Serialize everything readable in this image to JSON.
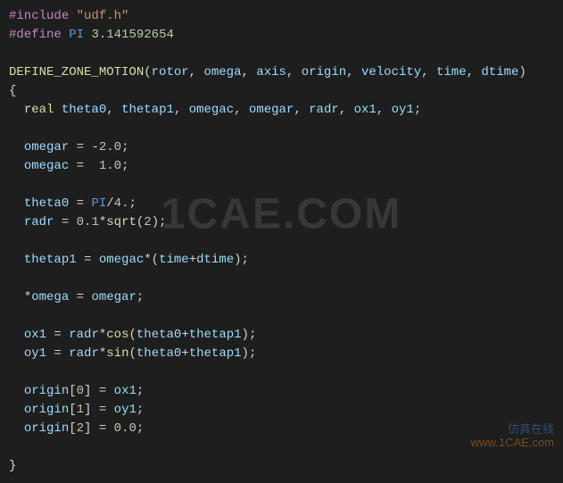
{
  "code": {
    "line01": {
      "hash": "#",
      "include": "include",
      "space": " ",
      "header": "\"udf.h\""
    },
    "line02": {
      "hash": "#",
      "define": "define",
      "space1": " ",
      "macro": "PI",
      "space2": " ",
      "value": "3.141592654"
    },
    "line04": {
      "funcname": "DEFINE_ZONE_MOTION",
      "open": "(",
      "p1": "rotor",
      "c1": ", ",
      "p2": "omega",
      "c2": ", ",
      "p3": "axis",
      "c3": ", ",
      "p4": "origin",
      "c4": ", ",
      "p5": "velocity",
      "c5": ", ",
      "p6": "time",
      "c6": ", ",
      "p7": "dtime",
      "close": ")"
    },
    "line05": {
      "brace": "{"
    },
    "line06": {
      "indent": "  ",
      "kw": "real",
      "sp": " ",
      "v1": "theta0",
      "c1": ", ",
      "v2": "thetap1",
      "c2": ", ",
      "v3": "omegac",
      "c3": ", ",
      "v4": "omegar",
      "c4": ", ",
      "v5": "radr",
      "c5": ", ",
      "v6": "ox1",
      "c6": ", ",
      "v7": "oy1",
      "semi": ";"
    },
    "line08": {
      "indent": "  ",
      "lhs": "omegar",
      "eq": " = ",
      "neg": "-",
      "num": "2.0",
      "semi": ";"
    },
    "line09": {
      "indent": "  ",
      "lhs": "omegac",
      "eq": " =  ",
      "num": "1.0",
      "semi": ";"
    },
    "line11": {
      "indent": "  ",
      "lhs": "theta0",
      "eq": " = ",
      "pi": "PI",
      "slash": "/",
      "num": "4.",
      "semi": ";"
    },
    "line12": {
      "indent": "  ",
      "lhs": "radr",
      "eq": " = ",
      "n1": "0.1",
      "mul": "*",
      "fn": "sqrt",
      "op": "(",
      "n2": "2",
      "cl": ")",
      "semi": ";"
    },
    "line14": {
      "indent": "  ",
      "lhs": "thetap1",
      "eq": " = ",
      "v1": "omegac",
      "mul": "*",
      "op": "(",
      "v2": "time",
      "plus": "+",
      "v3": "dtime",
      "cl": ")",
      "semi": ";"
    },
    "line16": {
      "indent": "  ",
      "star": "*",
      "lhs": "omega",
      "eq": " = ",
      "rhs": "omegar",
      "semi": ";"
    },
    "line18": {
      "indent": "  ",
      "lhs": "ox1",
      "eq": " = ",
      "v1": "radr",
      "mul": "*",
      "fn": "cos",
      "op": "(",
      "a1": "theta0",
      "plus": "+",
      "a2": "thetap1",
      "cl": ")",
      "semi": ";"
    },
    "line19": {
      "indent": "  ",
      "lhs": "oy1",
      "eq": " = ",
      "v1": "radr",
      "mul": "*",
      "fn": "sin",
      "op": "(",
      "a1": "theta0",
      "plus": "+",
      "a2": "thetap1",
      "cl": ")",
      "semi": ";"
    },
    "line21": {
      "indent": "  ",
      "arr": "origin",
      "ob": "[",
      "idx": "0",
      "cb": "]",
      "eq": " = ",
      "rhs": "ox1",
      "semi": ";"
    },
    "line22": {
      "indent": "  ",
      "arr": "origin",
      "ob": "[",
      "idx": "1",
      "cb": "]",
      "eq": " = ",
      "rhs": "oy1",
      "semi": ";"
    },
    "line23": {
      "indent": "  ",
      "arr": "origin",
      "ob": "[",
      "idx": "2",
      "cb": "]",
      "eq": " = ",
      "rhs": "0.0",
      "semi": ";"
    },
    "line25": {
      "brace": "}"
    }
  },
  "watermark": {
    "center": "1CAE.COM",
    "corner_title": "仿真在线",
    "corner_url": "www.1CAE.com"
  }
}
